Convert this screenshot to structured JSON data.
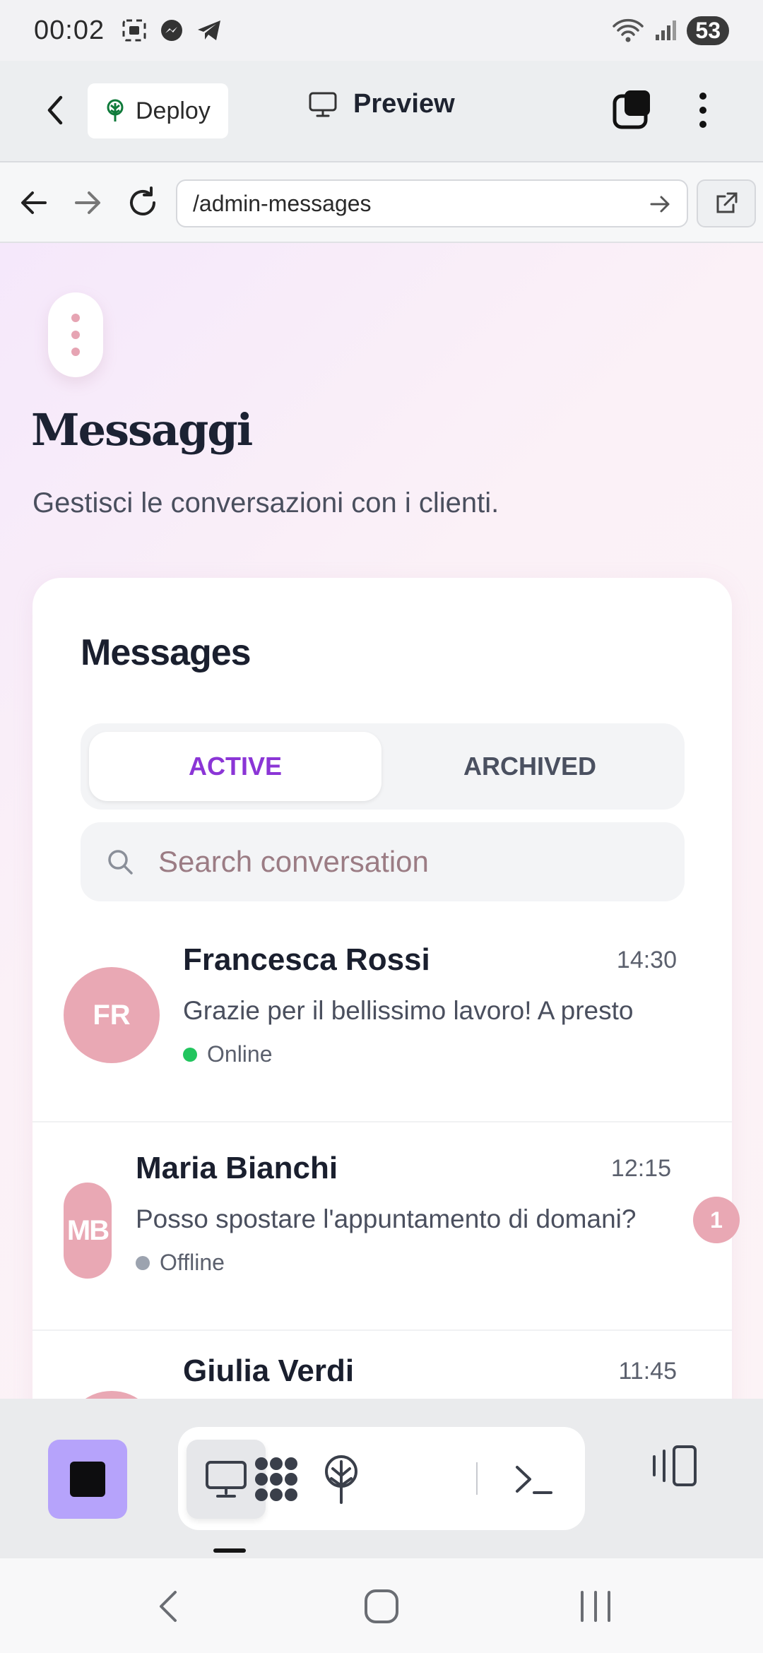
{
  "status_bar": {
    "time": "00:02",
    "battery": "53"
  },
  "app_bar": {
    "deploy_label": "Deploy",
    "preview_label": "Preview"
  },
  "browser": {
    "url": "/admin-messages"
  },
  "page": {
    "title": "Messaggi",
    "subtitle": "Gestisci le conversazioni con i clienti."
  },
  "card": {
    "title": "Messages",
    "tabs": {
      "active": "ACTIVE",
      "archived": "ARCHIVED"
    },
    "search_placeholder": "Search conversation",
    "conversations": [
      {
        "initials": "FR",
        "name": "Francesca Rossi",
        "time": "14:30",
        "message": "Grazie per il bellissimo lavoro! A presto",
        "status": "Online",
        "status_color": "#22c55e"
      },
      {
        "initials": "MB",
        "name": "Maria Bianchi",
        "time": "12:15",
        "message": "Posso spostare l'appuntamento di domani?",
        "status": "Offline",
        "status_color": "#9ca3af",
        "unread": "1"
      },
      {
        "initials": "",
        "name": "Giulia Verdi",
        "time": "11:45"
      }
    ]
  },
  "colors": {
    "accent": "#8b35d6",
    "avatar": "#e9a8b4",
    "stop": "#b6a3fb"
  }
}
